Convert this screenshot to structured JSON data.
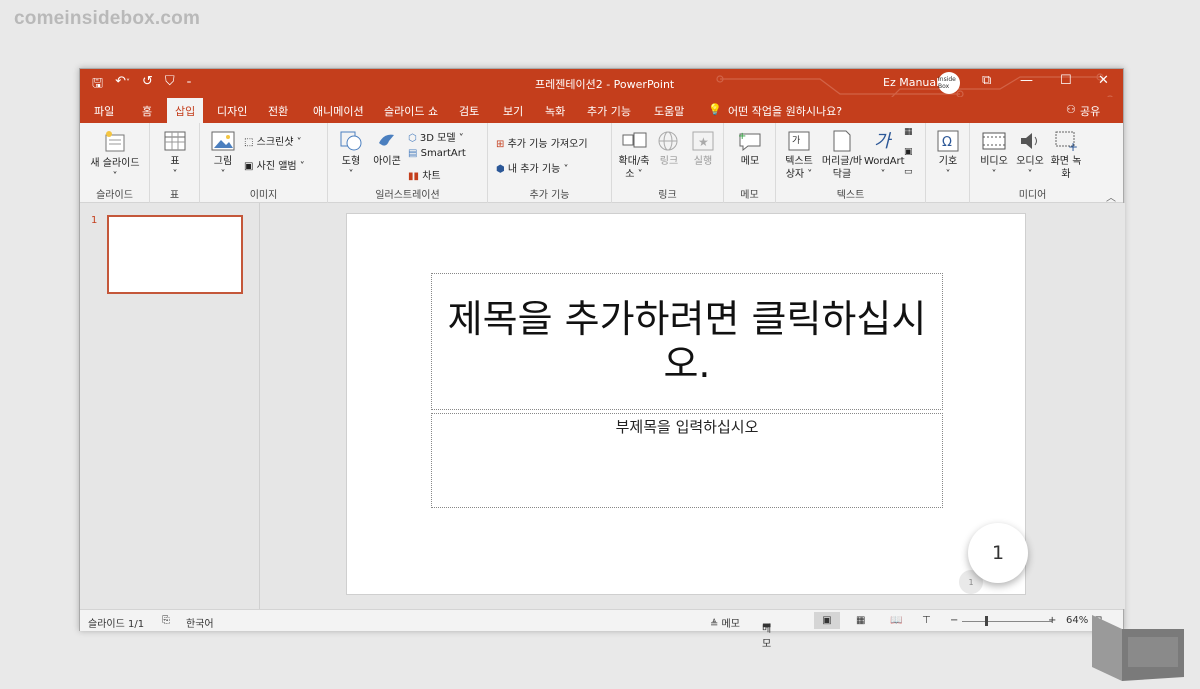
{
  "watermark": "comeinsidebox.com",
  "titlebar": {
    "qat_save": "🖫",
    "qat_undo": "↶",
    "qat_undo_dd": "˅",
    "qat_redo": "↺",
    "qat_present": "⛉",
    "qat_more": "₌",
    "title": "프레젠테이션2  -  PowerPoint",
    "user": "Ez Manual",
    "avatar_text": "Inside Box",
    "restore": "⧉",
    "minimize": "—",
    "maximize": "☐",
    "close": "✕"
  },
  "menu": {
    "tabs": [
      "파일",
      "홈",
      "삽입",
      "디자인",
      "전환",
      "애니메이션",
      "슬라이드 쇼",
      "검토",
      "보기",
      "녹화",
      "추가 기능",
      "도움말"
    ],
    "tell_me": "어떤 작업을 원하시나요?",
    "share": "공유"
  },
  "ribbon": {
    "slides": {
      "new_slide": "새 슬라이드",
      "dd": "˅",
      "label": "슬라이드"
    },
    "table": {
      "table": "표",
      "dd": "˅",
      "label": "표"
    },
    "images": {
      "picture": "그림",
      "dd": "˅",
      "screenshot": "스크린샷",
      "album": "사진 앨범",
      "label": "이미지"
    },
    "illustrations": {
      "shapes": "도형",
      "icons": "아이콘",
      "model3d": "3D 모델",
      "smartart": "SmartArt",
      "chart": "차트",
      "label": "일러스트레이션"
    },
    "addins": {
      "get": "추가 기능 가져오기",
      "my": "내 추가 기능",
      "label": "추가 기능"
    },
    "links": {
      "zoom": "확대/축소",
      "link": "링크",
      "action": "실행",
      "label": "링크"
    },
    "comments": {
      "comment": "메모",
      "label": "메모"
    },
    "text": {
      "textbox": "텍스트 상자",
      "header_footer": "머리글/바닥글",
      "wordart": "WordArt",
      "label": "텍스트"
    },
    "symbols": {
      "symbol": "기호",
      "label": ""
    },
    "media": {
      "video": "비디오",
      "audio": "오디오",
      "screen_rec": "화면 녹화",
      "label": "미디어"
    }
  },
  "thumbs": {
    "num": "1"
  },
  "slide": {
    "title_placeholder": "제목을 추가하려면 클릭하십시오.",
    "subtitle_placeholder": "부제목을 입력하십시오",
    "slide_num_small": "1"
  },
  "overlay": {
    "circle_num": "1"
  },
  "status": {
    "slide": "슬라이드 1/1",
    "lang": "한국어",
    "notes": "≜ 메모",
    "comments": "메모",
    "zoom_minus": "−",
    "zoom_plus": "+",
    "zoom": "64%"
  },
  "colors": {
    "accent": "#c43e1c",
    "ribbon_bg": "#f3f3f3"
  }
}
